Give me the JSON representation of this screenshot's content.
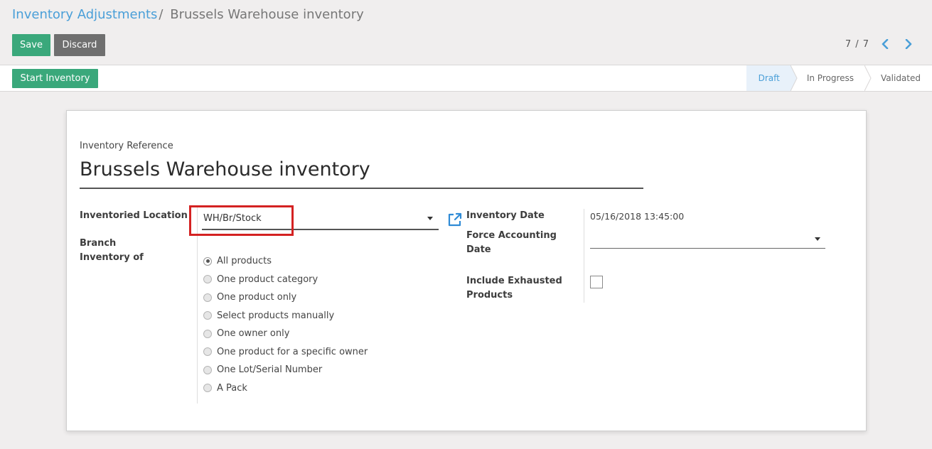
{
  "breadcrumb": {
    "parent": "Inventory Adjustments",
    "separator": "/",
    "current": "Brussels Warehouse inventory"
  },
  "toolbar": {
    "save_label": "Save",
    "discard_label": "Discard"
  },
  "pager": {
    "value": "7 / 7"
  },
  "statusbar": {
    "start_label": "Start Inventory",
    "steps": [
      "Draft",
      "In Progress",
      "Validated"
    ],
    "active_step": "Draft"
  },
  "form": {
    "reference_label": "Inventory Reference",
    "reference_value": "Brussels Warehouse inventory",
    "location_label": "Inventoried Location",
    "location_value": "WH/Br/Stock",
    "branch_label": "Branch",
    "inventory_of_label": "Inventory of",
    "inventory_of_options": [
      "All products",
      "One product category",
      "One product only",
      "Select products manually",
      "One owner only",
      "One product for a specific owner",
      "One Lot/Serial Number",
      "A Pack"
    ],
    "inventory_of_selected": "All products",
    "date_label": "Inventory Date",
    "date_value": "05/16/2018 13:45:00",
    "accounting_date_label_1": "Force Accounting",
    "accounting_date_label_2": "Date",
    "accounting_date_value": "",
    "exhausted_label_1": "Include Exhausted",
    "exhausted_label_2": "Products",
    "exhausted_checked": false
  },
  "colors": {
    "primary": "#3aa87b",
    "secondary": "#6f6f6f",
    "link": "#4a9fd8",
    "highlight_box": "#d42222"
  }
}
